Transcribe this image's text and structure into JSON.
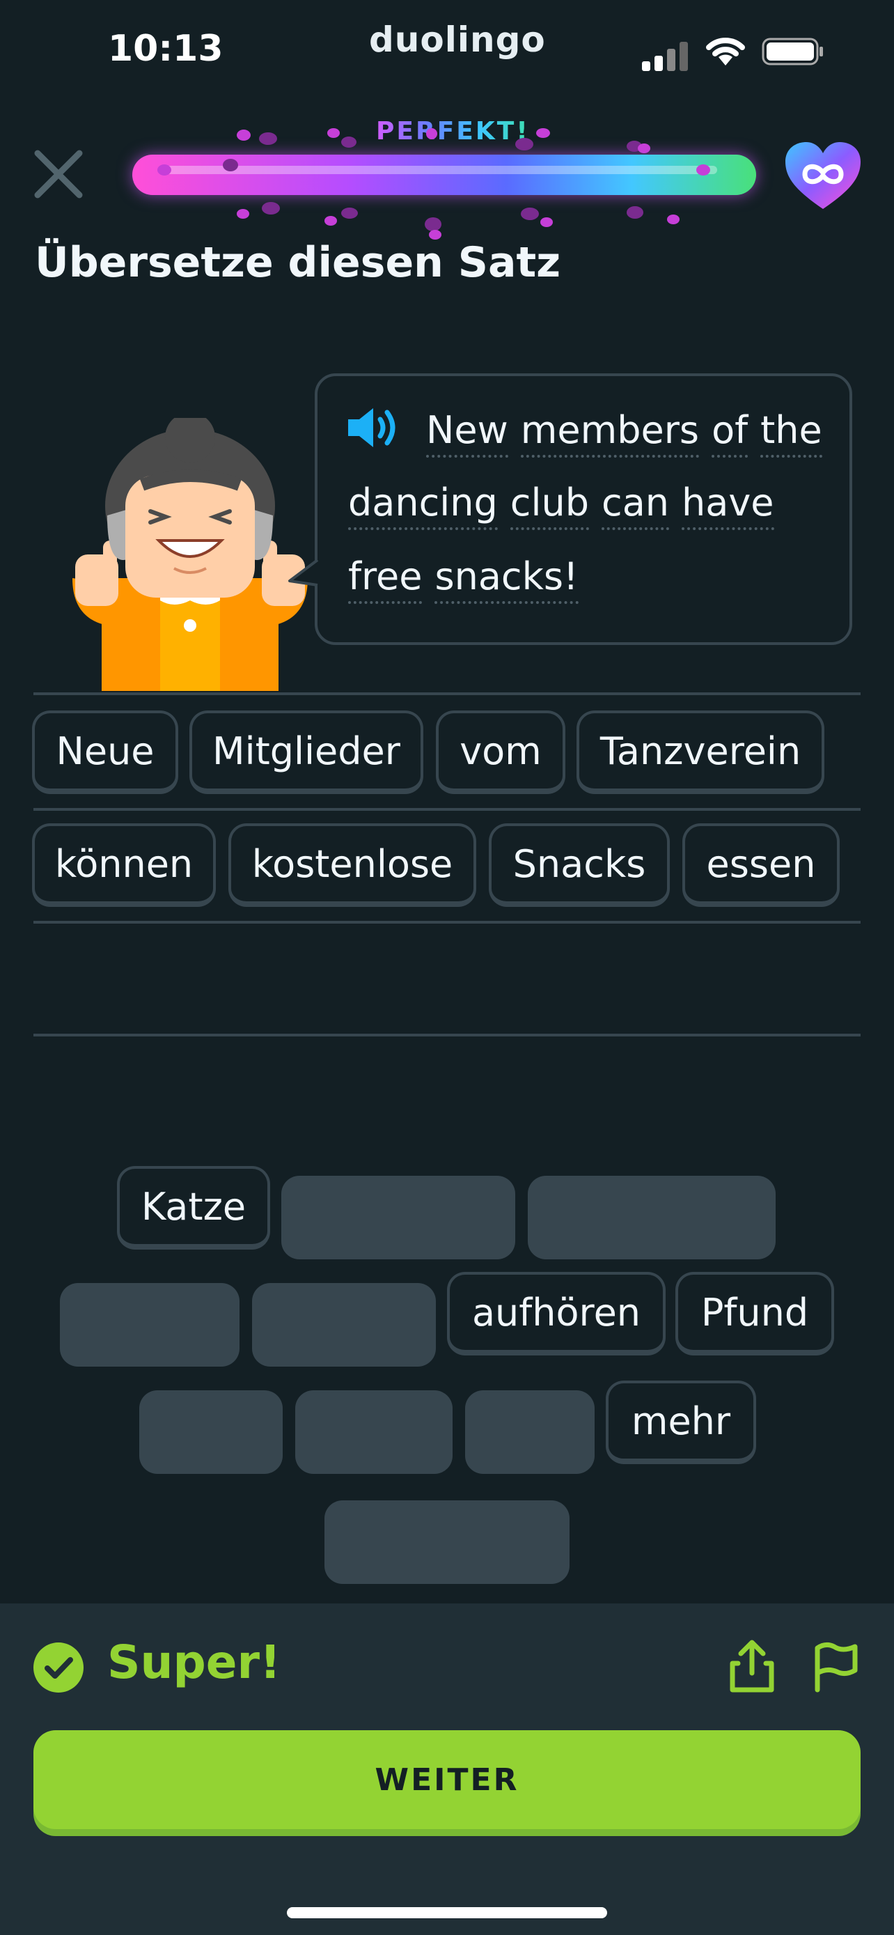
{
  "status_bar": {
    "time": "10:13",
    "app_name": "duolingo"
  },
  "progress": {
    "value": 1.0,
    "label": "PERFEKT!"
  },
  "hearts": {
    "label": "∞",
    "icon": "infinity-heart-icon"
  },
  "prompt": {
    "title": "Übersetze diesen Satz"
  },
  "sentence": {
    "lines": [
      [
        "New",
        "members",
        "of",
        "the"
      ],
      [
        "dancing",
        "club",
        "can",
        "have"
      ],
      [
        "free",
        "snacks!"
      ]
    ]
  },
  "answer": {
    "row1": [
      "Neue",
      "Mitglieder",
      "vom",
      "Tanzverein"
    ],
    "row2": [
      "können",
      "kostenlose",
      "Snacks",
      "essen"
    ]
  },
  "word_bank": {
    "remaining": [
      "Katze",
      "aufhören",
      "Pfund",
      "mehr"
    ]
  },
  "feedback": {
    "message": "Super!",
    "continue_label": "WEITER"
  },
  "colors": {
    "background": "#131f24",
    "accent_green": "#93d333",
    "tile_border": "#37464f",
    "speaker_blue": "#1cb0f6"
  }
}
